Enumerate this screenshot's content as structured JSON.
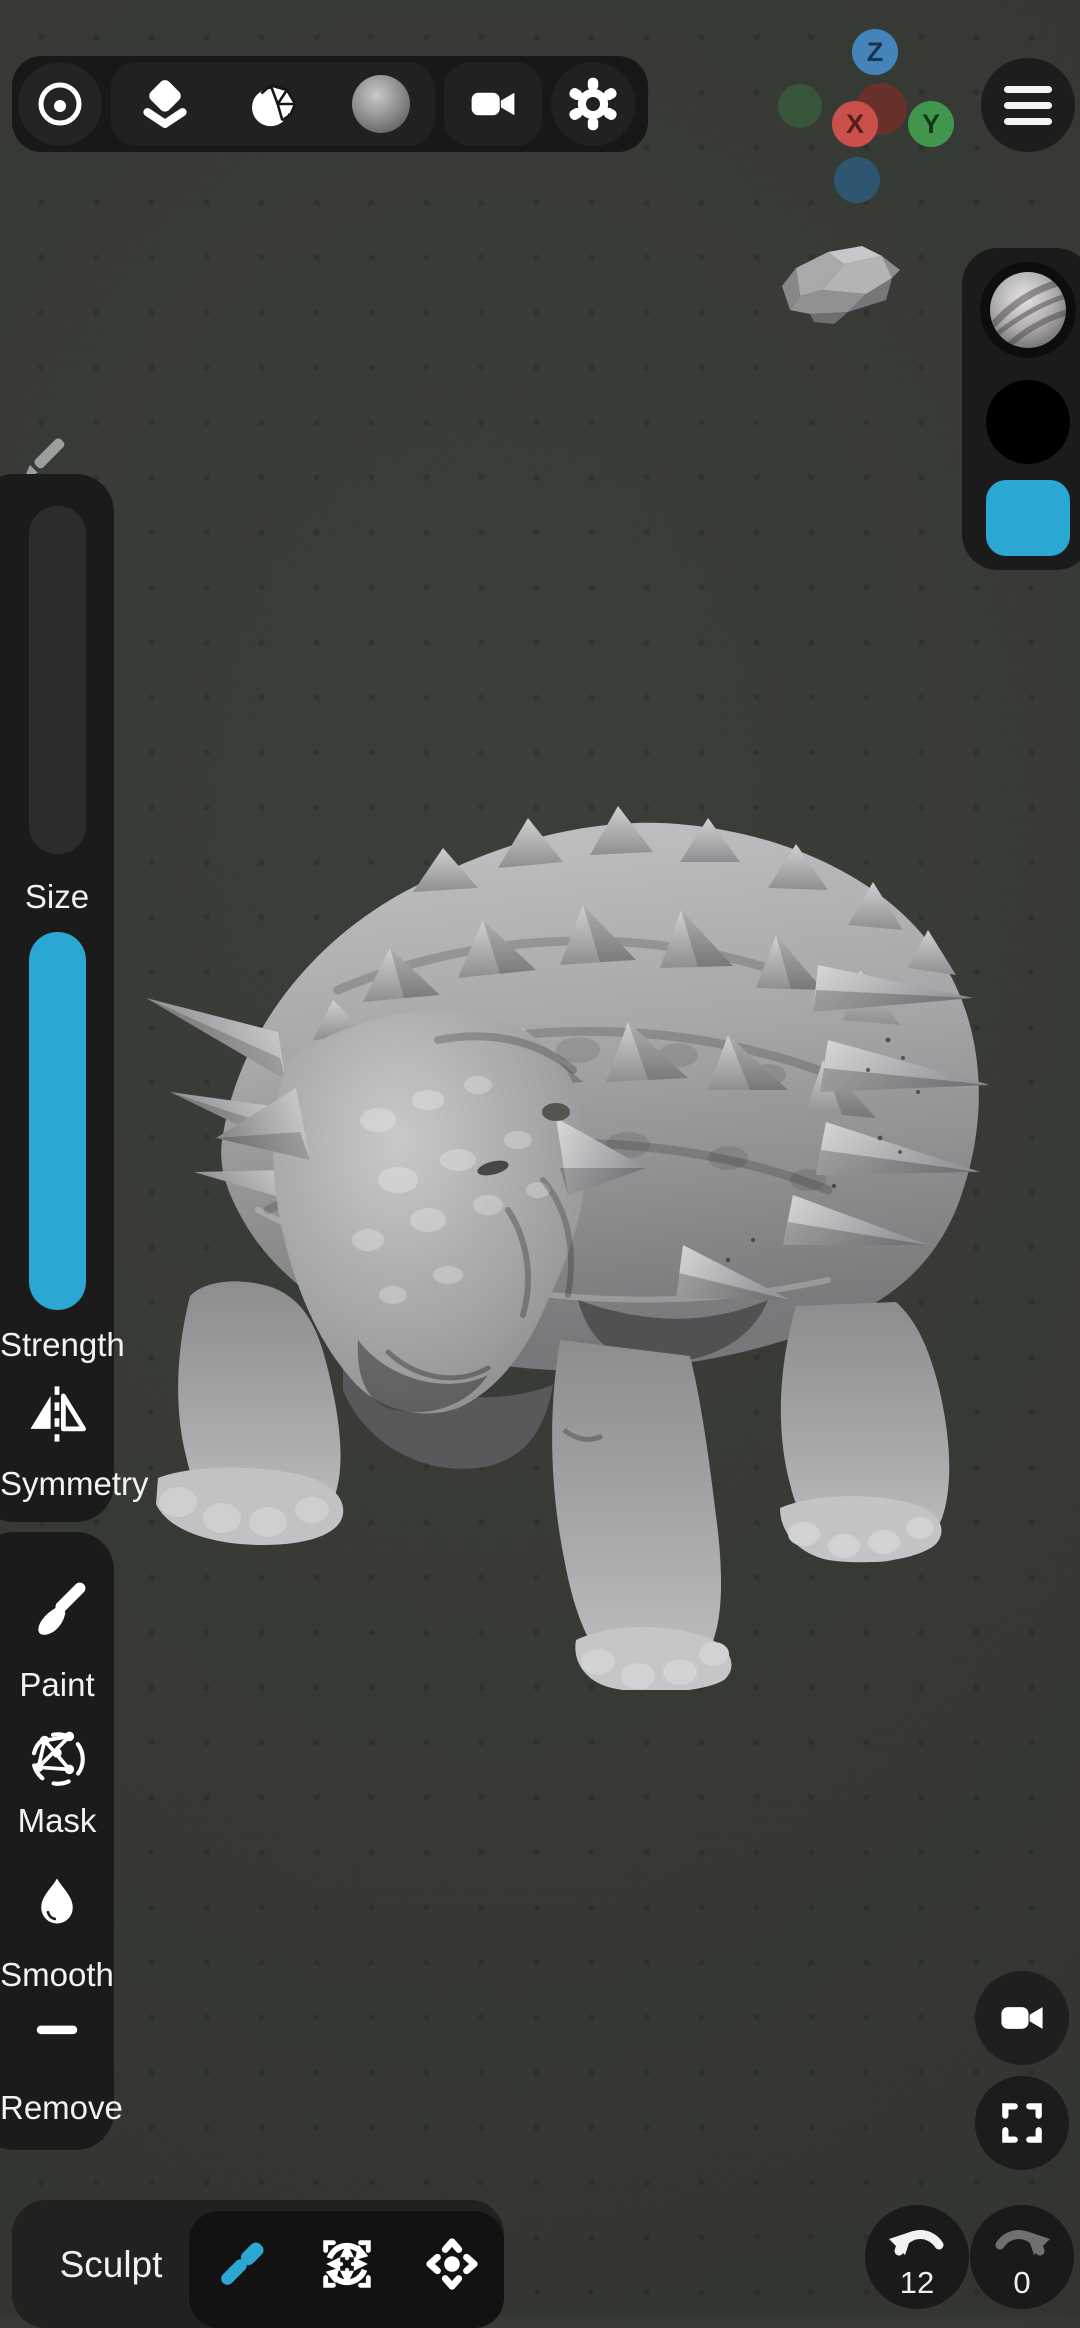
{
  "colors": {
    "accent_cyan": "#2ba7d3",
    "background": "#353833",
    "panel": "#1b1b1b",
    "gizmo_x_red": "#cb4f4b",
    "gizmo_y_green": "#42954d",
    "gizmo_z_blue": "#4584bb"
  },
  "top_toolbar": {
    "icons": [
      {
        "name": "stroke-circle-icon"
      },
      {
        "name": "layers-icon"
      },
      {
        "name": "topology-sphere-icon"
      },
      {
        "name": "material-sphere-icon"
      },
      {
        "name": "camera-icon"
      },
      {
        "name": "settings-gear-icon"
      }
    ]
  },
  "menu": {
    "icon": "hamburger-menu-icon"
  },
  "gizmo": {
    "x": "X",
    "y": "Y",
    "z": "Z"
  },
  "palette": {
    "swatches": [
      {
        "name": "matcap-material-swatch"
      },
      {
        "name": "black-color-swatch"
      },
      {
        "name": "cyan-color-swatch",
        "hex": "#2ba7d3"
      }
    ]
  },
  "sliders": {
    "size_label": "Size",
    "strength_label": "Strength",
    "size_fill_pct": 0,
    "strength_fill_pct": 100
  },
  "symmetry": {
    "label": "Symmetry",
    "icon": "symmetry-mirror-icon"
  },
  "tools": {
    "items": [
      {
        "icon": "paint-brush-icon",
        "label": "Paint"
      },
      {
        "icon": "mask-lasso-icon",
        "label": "Mask"
      },
      {
        "icon": "smooth-drop-icon",
        "label": "Smooth"
      },
      {
        "icon": "remove-minus-icon",
        "label": "Remove"
      }
    ]
  },
  "bottom_bar": {
    "mode_label": "Sculpt",
    "icons": [
      {
        "name": "clay-brush-icon",
        "color": "#2ba7d3"
      },
      {
        "name": "transform-gizmo-icon"
      },
      {
        "name": "move-pan-icon"
      }
    ]
  },
  "view_buttons": {
    "camera": "video-camera-icon",
    "fullscreen": "fullscreen-icon"
  },
  "history": {
    "undo_count": "12",
    "redo_count": "0"
  }
}
